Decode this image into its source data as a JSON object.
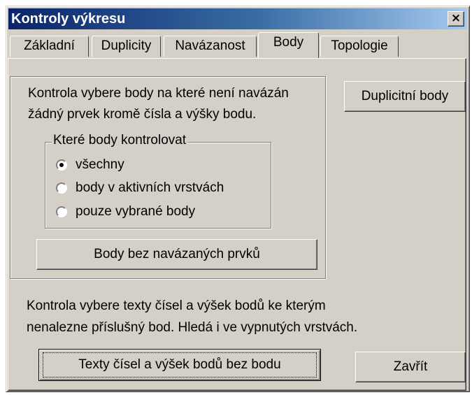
{
  "window": {
    "title": "Kontroly výkresu",
    "close_glyph": "×"
  },
  "tabs": [
    {
      "label": "Základní"
    },
    {
      "label": "Duplicity"
    },
    {
      "label": "Navázanost"
    },
    {
      "label": "Body"
    },
    {
      "label": "Topologie"
    }
  ],
  "active_tab": "Body",
  "points_check": {
    "description_line1": "Kontrola vybere body na které není navázán",
    "description_line2": "žádný prvek kromě čísla a výšky bodu.",
    "group_label": "Které body kontrolovat",
    "options": [
      {
        "label": "všechny",
        "checked": true
      },
      {
        "label": "body v aktivních vrstvách",
        "checked": false
      },
      {
        "label": "pouze vybrané body",
        "checked": false
      }
    ],
    "button_label": "Body bez navázaných prvků"
  },
  "duplicates_button": "Duplicitní body",
  "texts_check": {
    "description_line1": "Kontrola vybere texty čísel a výšek bodů ke kterým",
    "description_line2": "nenalezne příslušný bod. Hledá i ve vypnutých vrstvách.",
    "button_label": "Texty čísel a výšek bodů bez bodu"
  },
  "close_button": "Zavřít"
}
